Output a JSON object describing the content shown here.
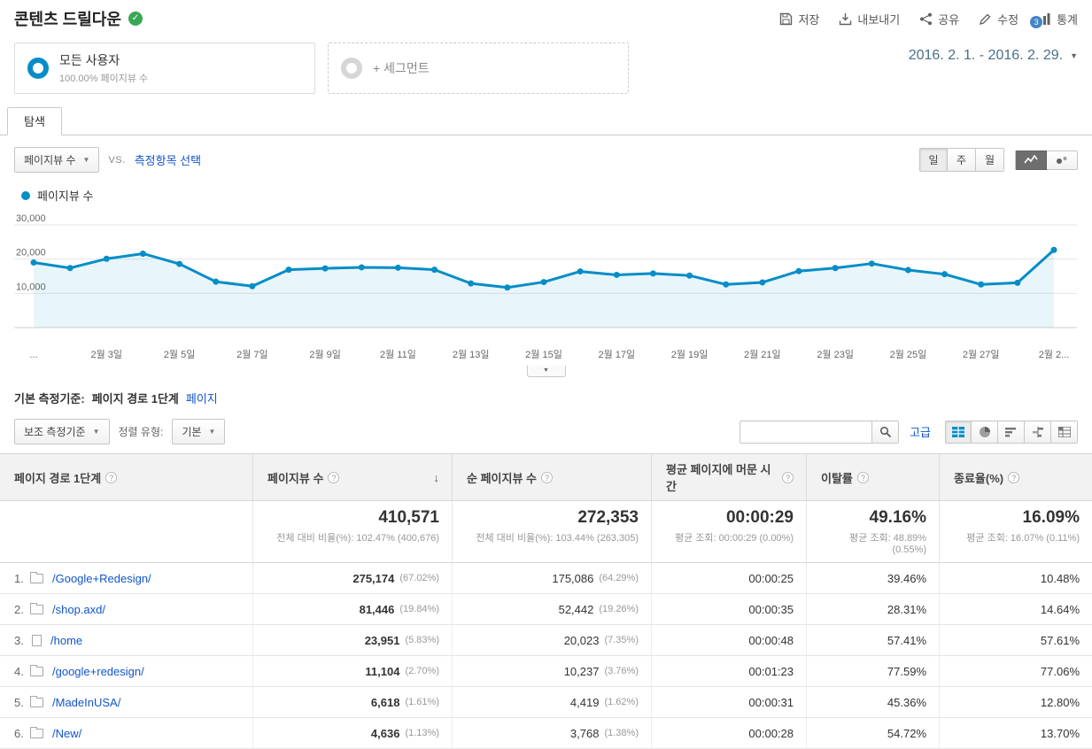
{
  "header": {
    "title": "콘텐츠 드릴다운",
    "actions": [
      {
        "icon": "save-icon",
        "label": "저장"
      },
      {
        "icon": "export-icon",
        "label": "내보내기"
      },
      {
        "icon": "share-icon",
        "label": "공유"
      },
      {
        "icon": "edit-icon",
        "label": "수정"
      },
      {
        "icon": "intelligence-icon",
        "label": "통계",
        "badge": "3"
      }
    ]
  },
  "segments": {
    "all_users": {
      "title": "모든 사용자",
      "subtitle": "100.00% 페이지뷰 수"
    },
    "add_segment": "+ 세그먼트",
    "date_range": "2016. 2. 1. - 2016. 2. 29."
  },
  "tabs": [
    {
      "label": "탐색"
    }
  ],
  "explorer": {
    "metric_selector": "페이지뷰 수",
    "vs_label": "VS.",
    "select_metric": "측정항목 선택",
    "granularity": [
      "일",
      "주",
      "월"
    ],
    "legend": "페이지뷰 수"
  },
  "chart_data": {
    "type": "line",
    "title": "페이지뷰 수",
    "x": [
      "2월 1일",
      "2월 2일",
      "2월 3일",
      "2월 4일",
      "2월 5일",
      "2월 6일",
      "2월 7일",
      "2월 8일",
      "2월 9일",
      "2월 10일",
      "2월 11일",
      "2월 12일",
      "2월 13일",
      "2월 14일",
      "2월 15일",
      "2월 16일",
      "2월 17일",
      "2월 18일",
      "2월 19일",
      "2월 20일",
      "2월 21일",
      "2월 22일",
      "2월 23일",
      "2월 24일",
      "2월 25일",
      "2월 26일",
      "2월 27일",
      "2월 28일",
      "2월 29일"
    ],
    "values": [
      19000,
      17400,
      20100,
      21600,
      18600,
      13400,
      12100,
      16900,
      17300,
      17600,
      17500,
      16900,
      12900,
      11700,
      13300,
      16400,
      15400,
      15800,
      15200,
      12600,
      13200,
      16500,
      17400,
      18700,
      16800,
      15600,
      12600,
      13100,
      22700
    ],
    "ylim": [
      0,
      30000
    ],
    "yticks": [
      10000,
      20000,
      30000
    ],
    "ytick_labels": [
      "10,000",
      "20,000",
      "30,000"
    ],
    "x_ticks": [
      {
        "i": 0,
        "label": "..."
      },
      {
        "i": 2,
        "label": "2월 3일"
      },
      {
        "i": 4,
        "label": "2월 5일"
      },
      {
        "i": 6,
        "label": "2월 7일"
      },
      {
        "i": 8,
        "label": "2월 9일"
      },
      {
        "i": 10,
        "label": "2월 11일"
      },
      {
        "i": 12,
        "label": "2월 13일"
      },
      {
        "i": 14,
        "label": "2월 15일"
      },
      {
        "i": 16,
        "label": "2월 17일"
      },
      {
        "i": 18,
        "label": "2월 19일"
      },
      {
        "i": 20,
        "label": "2월 21일"
      },
      {
        "i": 22,
        "label": "2월 23일"
      },
      {
        "i": 24,
        "label": "2월 25일"
      },
      {
        "i": 26,
        "label": "2월 27일"
      },
      {
        "i": 28,
        "label": "2월 2..."
      }
    ],
    "line_color": "#058dc7",
    "fill_color": "rgba(5,141,199,0.09)",
    "legend_position": "top-left",
    "grid": true
  },
  "dimension_bar": {
    "label": "기본 측정기준:",
    "active": "페이지 경로 1단계",
    "alt_link": "페이지"
  },
  "table_controls": {
    "secondary_dimension": "보조 측정기준",
    "sort_type_label": "정렬 유형:",
    "sort_type_value": "기본",
    "search_placeholder": "",
    "advanced": "고급",
    "view_icons": [
      "table-view-icon",
      "percentage-view-icon",
      "performance-view-icon",
      "comparison-view-icon",
      "pivot-view-icon"
    ]
  },
  "table": {
    "columns": [
      {
        "label": "페이지 경로 1단계"
      },
      {
        "label": "페이지뷰 수",
        "sorted": "desc"
      },
      {
        "label": "순 페이지뷰 수"
      },
      {
        "label": "평균 페이지에 머문 시간"
      },
      {
        "label": "이탈률"
      },
      {
        "label": "종료율(%)"
      }
    ],
    "summary": {
      "pageviews": "410,571",
      "pageviews_sub": "전체 대비 비율(%): 102.47% (400,676)",
      "unique_pageviews": "272,353",
      "unique_pageviews_sub": "전체 대비 비율(%): 103.44% (263,305)",
      "avg_time": "00:00:29",
      "avg_time_sub": "평균 조회: 00:00:29 (0.00%)",
      "bounce_rate": "49.16%",
      "bounce_rate_sub": "평균 조회: 48.89% (0.55%)",
      "exit_rate": "16.09%",
      "exit_rate_sub": "평균 조회: 16.07% (0.11%)"
    },
    "rows": [
      {
        "index": "1.",
        "icon": "folder",
        "path": "/Google+Redesign/",
        "pageviews": "275,174",
        "pageviews_pct": "(67.02%)",
        "unique": "175,086",
        "unique_pct": "(64.29%)",
        "avg_time": "00:00:25",
        "bounce": "39.46%",
        "exit": "10.48%"
      },
      {
        "index": "2.",
        "icon": "folder",
        "path": "/shop.axd/",
        "pageviews": "81,446",
        "pageviews_pct": "(19.84%)",
        "unique": "52,442",
        "unique_pct": "(19.26%)",
        "avg_time": "00:00:35",
        "bounce": "28.31%",
        "exit": "14.64%"
      },
      {
        "index": "3.",
        "icon": "page",
        "path": "/home",
        "pageviews": "23,951",
        "pageviews_pct": "(5.83%)",
        "unique": "20,023",
        "unique_pct": "(7.35%)",
        "avg_time": "00:00:48",
        "bounce": "57.41%",
        "exit": "57.61%"
      },
      {
        "index": "4.",
        "icon": "folder",
        "path": "/google+redesign/",
        "pageviews": "11,104",
        "pageviews_pct": "(2.70%)",
        "unique": "10,237",
        "unique_pct": "(3.76%)",
        "avg_time": "00:01:23",
        "bounce": "77.59%",
        "exit": "77.06%"
      },
      {
        "index": "5.",
        "icon": "folder",
        "path": "/MadeInUSA/",
        "pageviews": "6,618",
        "pageviews_pct": "(1.61%)",
        "unique": "4,419",
        "unique_pct": "(1.62%)",
        "avg_time": "00:00:31",
        "bounce": "45.36%",
        "exit": "12.80%"
      },
      {
        "index": "6.",
        "icon": "folder",
        "path": "/New/",
        "pageviews": "4,636",
        "pageviews_pct": "(1.13%)",
        "unique": "3,768",
        "unique_pct": "(1.38%)",
        "avg_time": "00:00:28",
        "bounce": "54.72%",
        "exit": "13.70%"
      }
    ]
  },
  "colors": {
    "accent_blue": "#058dc7",
    "link_blue": "#1155cc",
    "verified_green": "#3aa757",
    "badge_blue": "#4285c8"
  }
}
